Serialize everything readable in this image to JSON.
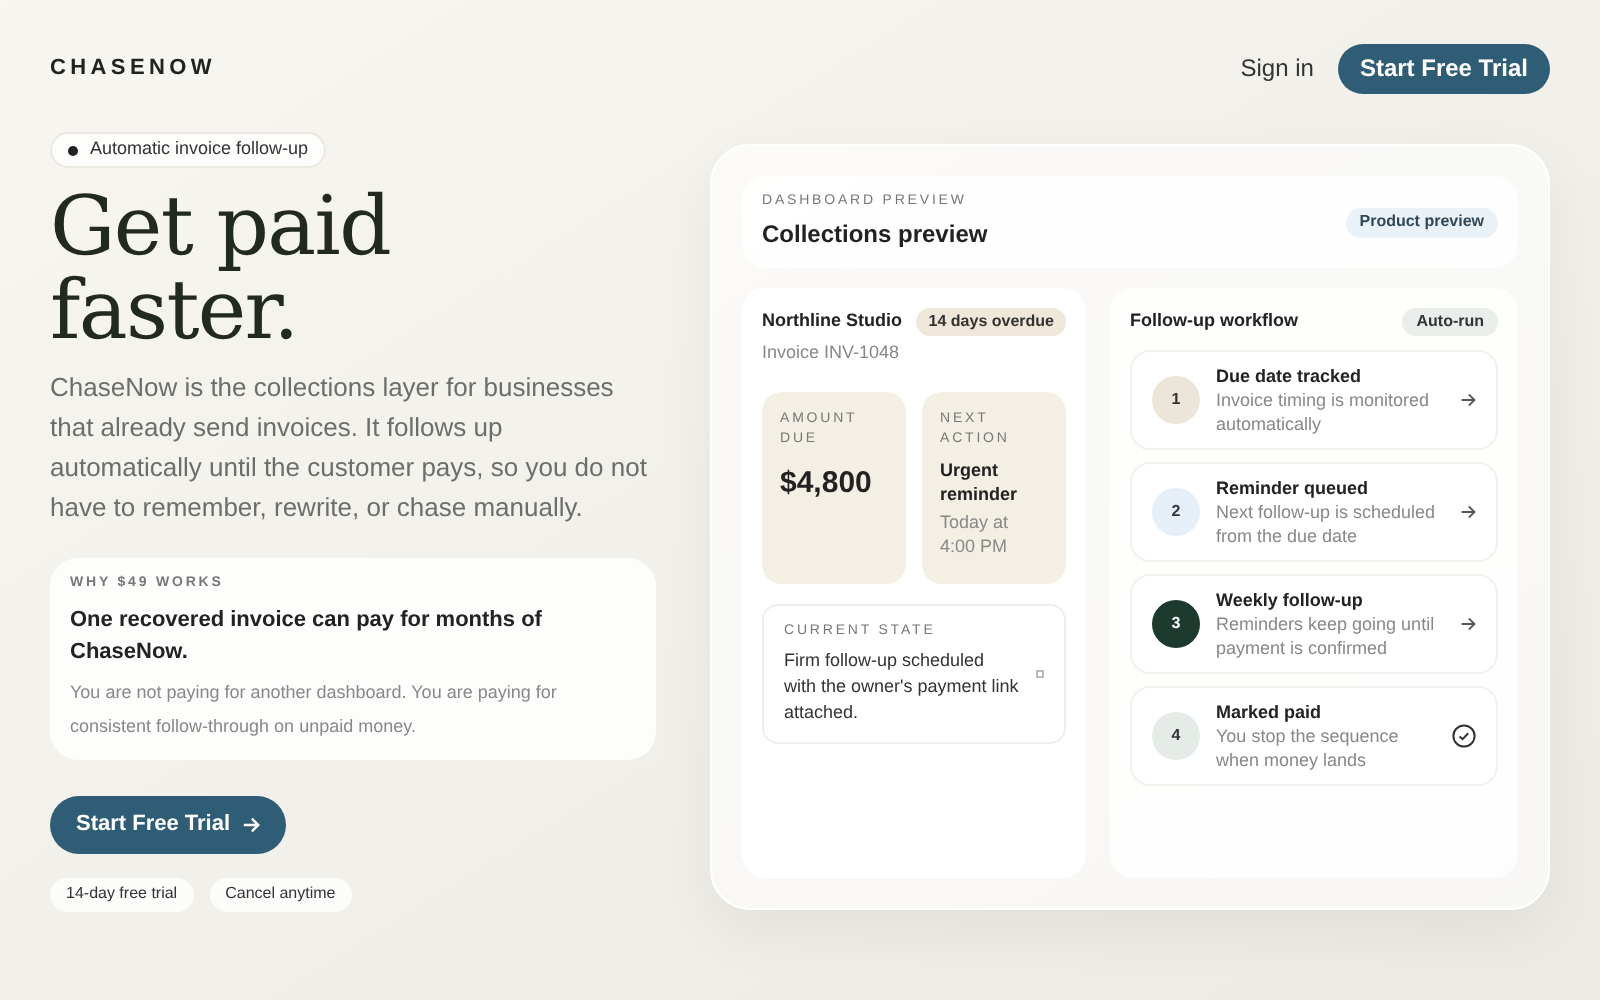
{
  "brand": "CHASENOW",
  "nav": {
    "sign_in": "Sign in",
    "cta": "Start Free Trial"
  },
  "hero": {
    "badge": "Automatic invoice follow-up",
    "title_lines": [
      "Get paid",
      "faster."
    ],
    "description": "ChaseNow is the collections layer for businesses that already send invoices. It follows up automatically until the customer pays, so you do not have to remember, rewrite, or chase manually.",
    "value_card": {
      "eyebrow": "WHY $49 WORKS",
      "heading": "One recovered invoice can pay for months of ChaseNow.",
      "body": "You are not paying for another dashboard. You are paying for consistent follow-through on unpaid money."
    },
    "cta": "Start Free Trial",
    "chips": [
      "14-day free trial",
      "Cancel anytime"
    ]
  },
  "preview": {
    "eyebrow": "DASHBOARD PREVIEW",
    "title": "Collections preview",
    "badge": "Product preview",
    "invoice": {
      "client": "Northline Studio",
      "status": "14 days overdue",
      "number": "Invoice INV-1048",
      "amount_label": "AMOUNT DUE",
      "amount": "$4,800",
      "next_label": "NEXT ACTION",
      "next_action": "Urgent reminder",
      "next_time": "Today at 4:00 PM",
      "state_label": "CURRENT STATE",
      "state": "Firm follow-up scheduled with the owner's payment link attached."
    },
    "workflow": {
      "title": "Follow-up workflow",
      "badge": "Auto-run",
      "steps": [
        {
          "number": "1",
          "title": "Due date tracked",
          "description": "Invoice timing is monitored automatically",
          "color": "#ece6da",
          "kind": "arrow"
        },
        {
          "number": "2",
          "title": "Reminder queued",
          "description": "Next follow-up is scheduled from the due date",
          "color": "#e6eef7",
          "kind": "arrow"
        },
        {
          "number": "3",
          "title": "Weekly follow-up",
          "description": "Reminders keep going until payment is confirmed",
          "color": "#1c3a2e",
          "kind": "arrow"
        },
        {
          "number": "4",
          "title": "Marked paid",
          "description": "You stop the sequence when money lands",
          "color": "#e5ebe6",
          "kind": "check"
        }
      ]
    }
  }
}
